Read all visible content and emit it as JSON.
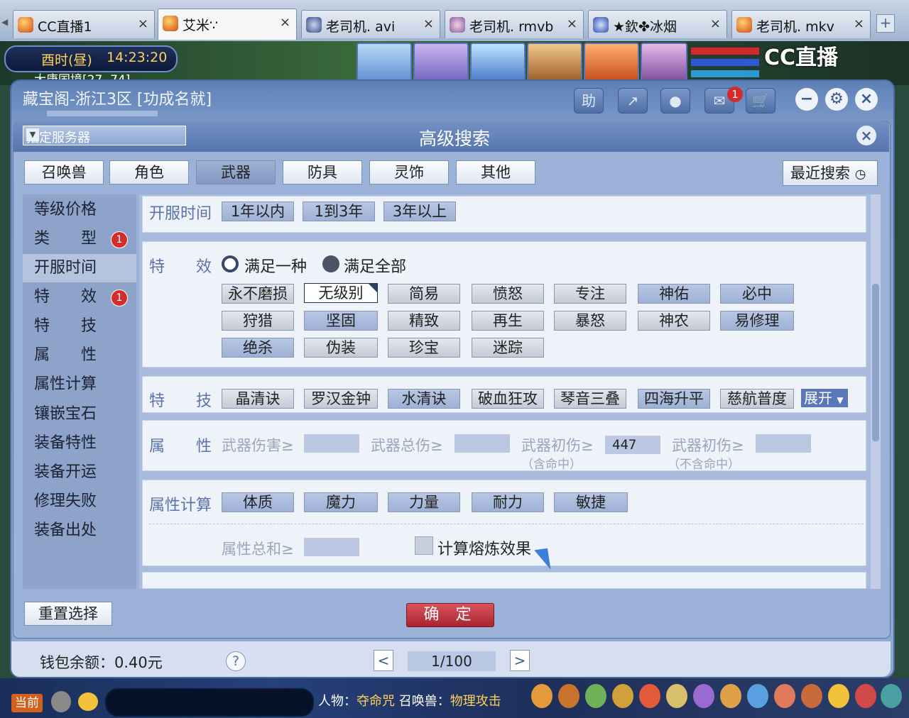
{
  "browser": {
    "tabs": [
      {
        "label": "CC直播1"
      },
      {
        "label": "艾米∵"
      },
      {
        "label": "老司机. avi"
      },
      {
        "label": "老司机. rmvb"
      },
      {
        "label": "★欽✤冰烟"
      },
      {
        "label": "老司机. mkv"
      }
    ],
    "close_glyph": "×",
    "add_glyph": "+"
  },
  "hud": {
    "clock_period": "酉时(昼)",
    "clock_time": "14:23:20",
    "map_name": "大唐国境[27, 74]",
    "watermark": "CC直播"
  },
  "panel": {
    "title": "藏宝阁-浙江3区 [功成名就]",
    "help_label": "助",
    "message_badge": "1"
  },
  "dialog": {
    "title": "高级搜索",
    "server_select": "指定服务器",
    "close_glyph": "×"
  },
  "category_tabs": [
    {
      "label": "召唤兽"
    },
    {
      "label": "角色"
    },
    {
      "label": "武器"
    },
    {
      "label": "防具"
    },
    {
      "label": "灵饰"
    },
    {
      "label": "其他"
    }
  ],
  "selected_category": "武器",
  "recent_search": "最近搜索",
  "nav": [
    {
      "label": "等级价格"
    },
    {
      "label": "类　　型",
      "badge": "1"
    },
    {
      "label": "开服时间"
    },
    {
      "label": "特　　效",
      "badge": "1"
    },
    {
      "label": "特　　技"
    },
    {
      "label": "属　　性"
    },
    {
      "label": "属性计算"
    },
    {
      "label": "镶嵌宝石"
    },
    {
      "label": "装备特性"
    },
    {
      "label": "装备开运"
    },
    {
      "label": "修理失败"
    },
    {
      "label": "装备出处"
    }
  ],
  "open_time": {
    "label": "开服时间",
    "options": [
      "1年以内",
      "1到3年",
      "3年以上"
    ]
  },
  "effects": {
    "label_a": "特",
    "label_b": "效",
    "radio_any": "满足一种",
    "radio_all": "满足全部",
    "options": [
      "永不磨损",
      "无级别",
      "简易",
      "愤怒",
      "专注",
      "神佑",
      "必中",
      "狩猎",
      "坚固",
      "精致",
      "再生",
      "暴怒",
      "神农",
      "易修理",
      "绝杀",
      "伪装",
      "珍宝",
      "迷踪"
    ],
    "selected": "无级别"
  },
  "skills": {
    "label_a": "特",
    "label_b": "技",
    "options": [
      "晶清诀",
      "罗汉金钟",
      "水清诀",
      "破血狂攻",
      "琴音三叠",
      "四海升平",
      "慈航普度"
    ],
    "expand": "展开"
  },
  "attributes": {
    "label_a": "属",
    "label_b": "性",
    "fields": [
      {
        "label": "武器伤害≥",
        "sub": "",
        "value": ""
      },
      {
        "label": "武器总伤≥",
        "sub": "",
        "value": ""
      },
      {
        "label": "武器初伤≥",
        "sub": "（含命中）",
        "value": "447"
      },
      {
        "label": "武器初伤≥",
        "sub": "（不含命中）",
        "value": ""
      }
    ]
  },
  "attr_calc": {
    "label": "属性计算",
    "options": [
      "体质",
      "魔力",
      "力量",
      "耐力",
      "敏捷"
    ],
    "sum_label": "属性总和≥",
    "sum_value": "",
    "smelt_label": "计算熔炼效果"
  },
  "actions": {
    "reset": "重置选择",
    "confirm": "确 定"
  },
  "footer": {
    "wallet": "钱包余额：0.40元",
    "help": "?",
    "page": "1/100",
    "prev": "<",
    "next": ">"
  },
  "gamebar": {
    "channel": "当前",
    "char_key": "人物：",
    "char_val": "夺命咒",
    "pet_key": "召唤兽：",
    "pet_val": "物理攻击"
  }
}
